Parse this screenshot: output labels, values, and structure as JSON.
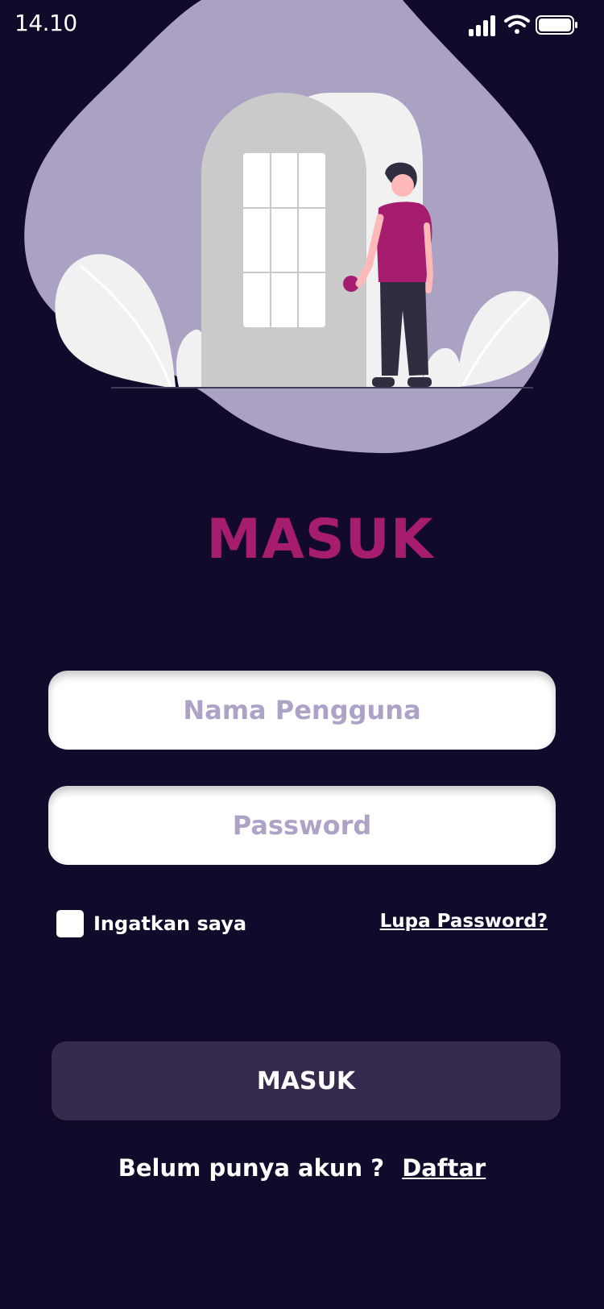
{
  "status_bar": {
    "time": "14.10",
    "icons": [
      "cellular-signal-icon",
      "wifi-icon",
      "battery-icon"
    ]
  },
  "illustration": {
    "name": "door-and-person-illustration"
  },
  "login": {
    "title": "MASUK",
    "username_placeholder": "Nama Pengguna",
    "password_placeholder": "Password",
    "remember_label": "Ingatkan saya",
    "forgot_label": "Lupa Password?",
    "submit_label": "MASUK",
    "register_prompt": "Belum punya akun ?",
    "register_link": "Daftar"
  },
  "colors": {
    "background": "#120A2A",
    "accent": "#A61C6E",
    "blob": "#ABA1C3",
    "button": "#372A4F",
    "placeholder": "#AEA3C6"
  }
}
